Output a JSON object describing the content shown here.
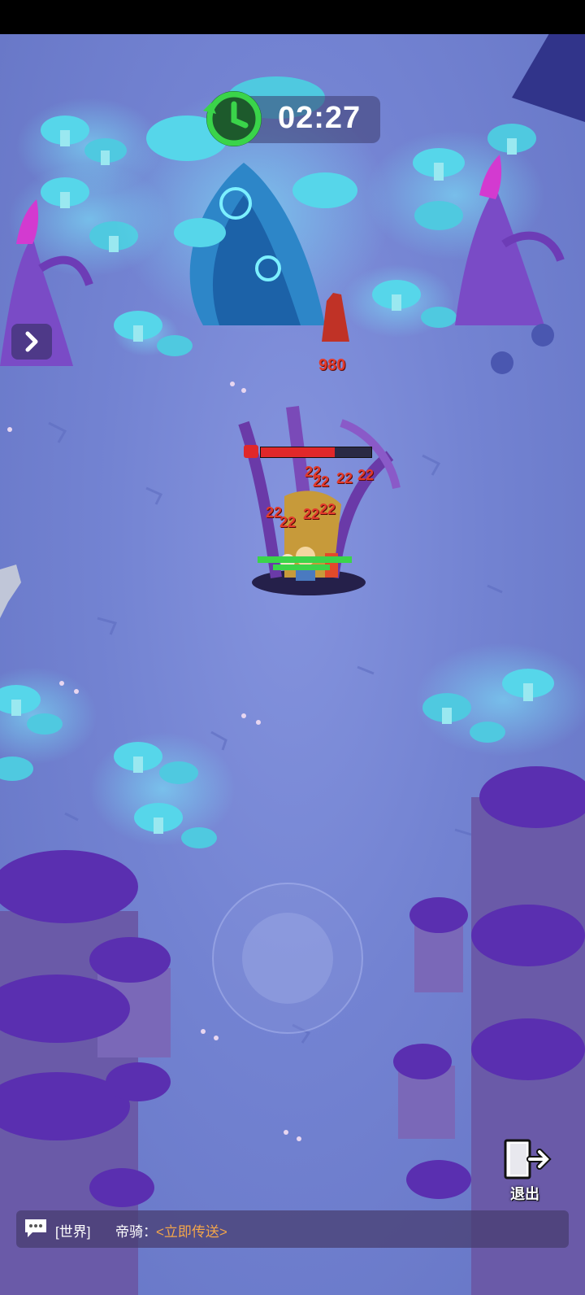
{
  "hud": {
    "timer": "02:27",
    "timer_icon": "clock-refresh-icon",
    "side_arrow_icon": "chevron-right-icon",
    "exit_label": "退出",
    "exit_icon": "exit-door-icon"
  },
  "chat": {
    "channel": "[世界]",
    "sender": "帝骑：",
    "message_link": "<立即传送>",
    "icon": "chat-bubble-icon"
  },
  "boss": {
    "hp_fraction": 0.68,
    "damage_numbers": [
      "22",
      "22",
      "22",
      "22",
      "22",
      "22",
      "22",
      "22"
    ],
    "tree_damage": "980"
  },
  "colors": {
    "accent_green": "#3ad44a",
    "chat_link": "#f4a64a",
    "damage_red": "#e23a2b",
    "boss_hp": "#e0282a"
  }
}
